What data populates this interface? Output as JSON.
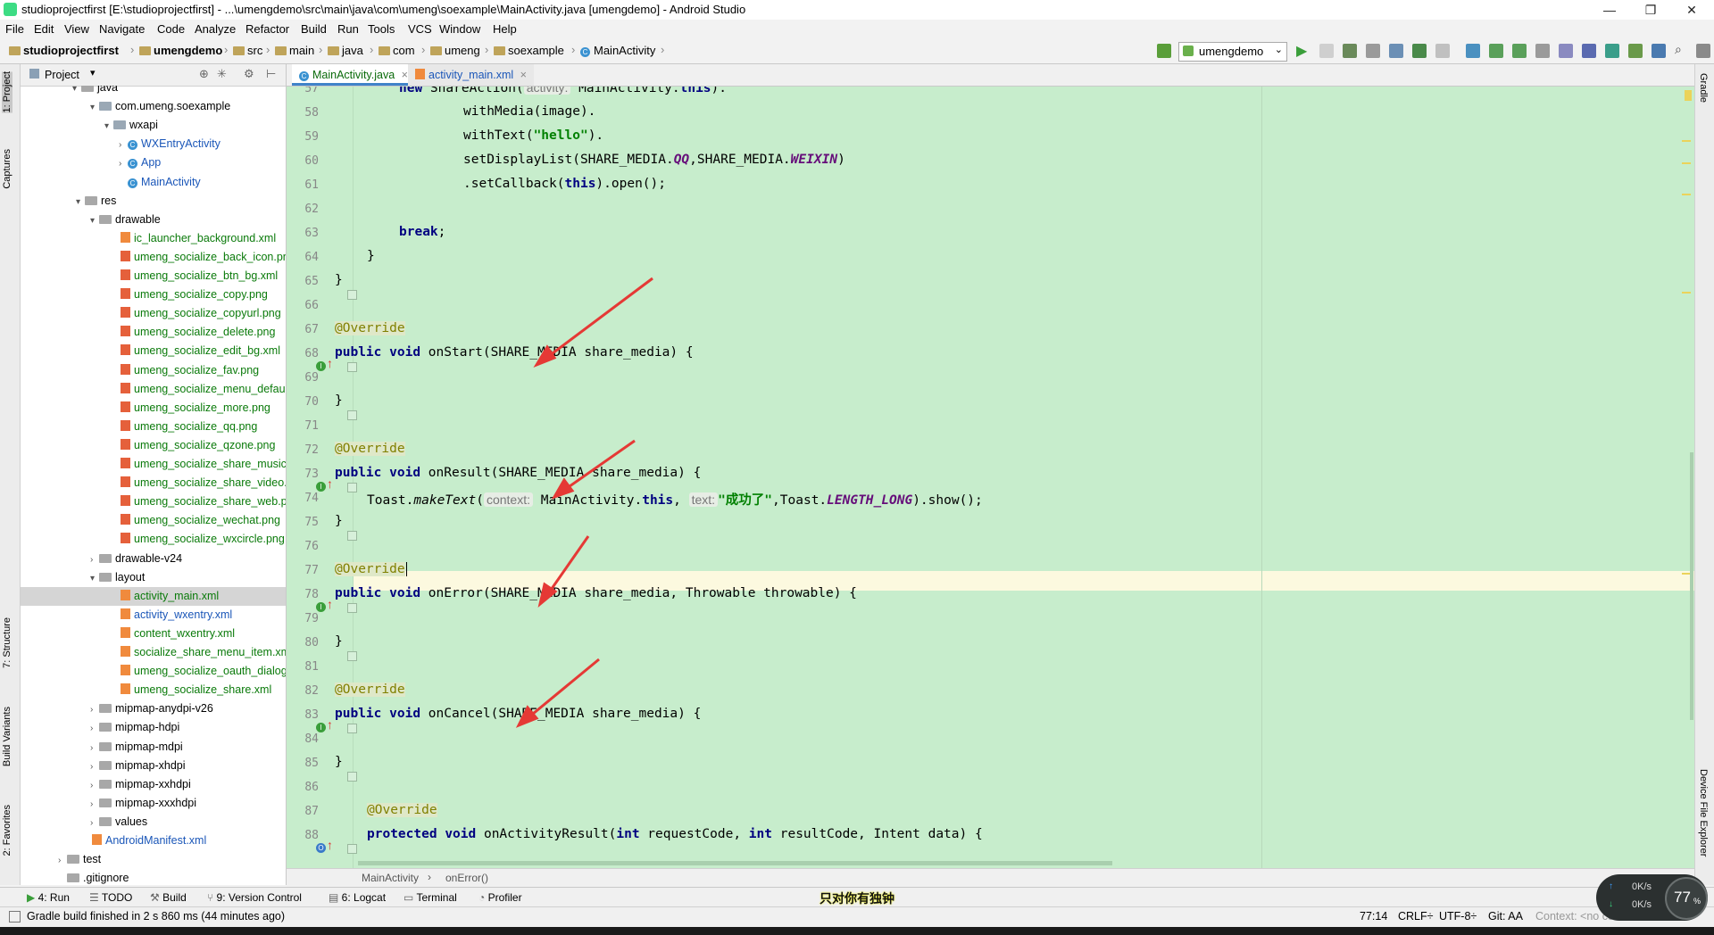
{
  "window": {
    "title": "studioprojectfirst [E:\\studioprojectfirst] - ...\\umengdemo\\src\\main\\java\\com\\umeng\\soexample\\MainActivity.java [umengdemo] - Android Studio",
    "minimize": "—",
    "maximize": "❐",
    "close": "✕"
  },
  "menu": [
    "File",
    "Edit",
    "View",
    "Navigate",
    "Code",
    "Analyze",
    "Refactor",
    "Build",
    "Run",
    "Tools",
    "VCS",
    "Window",
    "Help"
  ],
  "breadcrumb": [
    "studioprojectfirst",
    "umengdemo",
    "src",
    "main",
    "java",
    "com",
    "umeng",
    "soexample",
    "MainActivity"
  ],
  "run_config": "umengdemo",
  "left_tabs": {
    "project": "1: Project",
    "captures": "Captures",
    "structure": "7: Structure",
    "build_variants": "Build Variants",
    "favorites": "2: Favorites"
  },
  "right_tabs": {
    "gradle": "Gradle",
    "device_file_explorer": "Device File Explorer"
  },
  "project_panel": {
    "header": "Project",
    "tree": [
      {
        "label": "java",
        "type": "folder",
        "arrow": "▾"
      },
      {
        "label": "com.umeng.soexample",
        "type": "pkg",
        "arrow": "▾"
      },
      {
        "label": "wxapi",
        "type": "pkg",
        "arrow": "▾"
      },
      {
        "label": "WXEntryActivity",
        "type": "class",
        "arrow": "›"
      },
      {
        "label": "App",
        "type": "class",
        "arrow": "›"
      },
      {
        "label": "MainActivity",
        "type": "class",
        "arrow": ""
      },
      {
        "label": "res",
        "type": "folder",
        "arrow": "▾"
      },
      {
        "label": "drawable",
        "type": "folder",
        "arrow": "▾"
      },
      {
        "label": "ic_launcher_background.xml",
        "type": "xml",
        "arrow": ""
      },
      {
        "label": "umeng_socialize_back_icon.png",
        "type": "img",
        "arrow": ""
      },
      {
        "label": "umeng_socialize_btn_bg.xml",
        "type": "img",
        "arrow": ""
      },
      {
        "label": "umeng_socialize_copy.png",
        "type": "img",
        "arrow": ""
      },
      {
        "label": "umeng_socialize_copyurl.png",
        "type": "img",
        "arrow": ""
      },
      {
        "label": "umeng_socialize_delete.png",
        "type": "img",
        "arrow": ""
      },
      {
        "label": "umeng_socialize_edit_bg.xml",
        "type": "img",
        "arrow": ""
      },
      {
        "label": "umeng_socialize_fav.png",
        "type": "img",
        "arrow": ""
      },
      {
        "label": "umeng_socialize_menu_default.png",
        "type": "img",
        "arrow": ""
      },
      {
        "label": "umeng_socialize_more.png",
        "type": "img",
        "arrow": ""
      },
      {
        "label": "umeng_socialize_qq.png",
        "type": "img",
        "arrow": ""
      },
      {
        "label": "umeng_socialize_qzone.png",
        "type": "img",
        "arrow": ""
      },
      {
        "label": "umeng_socialize_share_music.png",
        "type": "img",
        "arrow": ""
      },
      {
        "label": "umeng_socialize_share_video.png",
        "type": "img",
        "arrow": ""
      },
      {
        "label": "umeng_socialize_share_web.png",
        "type": "img",
        "arrow": ""
      },
      {
        "label": "umeng_socialize_wechat.png",
        "type": "img",
        "arrow": ""
      },
      {
        "label": "umeng_socialize_wxcircle.png",
        "type": "img",
        "arrow": ""
      },
      {
        "label": "drawable-v24",
        "type": "folder",
        "arrow": "›"
      },
      {
        "label": "layout",
        "type": "folder",
        "arrow": "▾"
      },
      {
        "label": "activity_main.xml",
        "type": "xml",
        "arrow": "",
        "selected": true
      },
      {
        "label": "activity_wxentry.xml",
        "type": "xml",
        "arrow": ""
      },
      {
        "label": "content_wxentry.xml",
        "type": "xml",
        "arrow": ""
      },
      {
        "label": "socialize_share_menu_item.xml",
        "type": "xml",
        "arrow": ""
      },
      {
        "label": "umeng_socialize_oauth_dialog.xml",
        "type": "xml",
        "arrow": ""
      },
      {
        "label": "umeng_socialize_share.xml",
        "type": "xml",
        "arrow": ""
      },
      {
        "label": "mipmap-anydpi-v26",
        "type": "folder",
        "arrow": "›"
      },
      {
        "label": "mipmap-hdpi",
        "type": "folder",
        "arrow": "›"
      },
      {
        "label": "mipmap-mdpi",
        "type": "folder",
        "arrow": "›"
      },
      {
        "label": "mipmap-xhdpi",
        "type": "folder",
        "arrow": "›"
      },
      {
        "label": "mipmap-xxhdpi",
        "type": "folder",
        "arrow": "›"
      },
      {
        "label": "mipmap-xxxhdpi",
        "type": "folder",
        "arrow": "›"
      },
      {
        "label": "values",
        "type": "folder",
        "arrow": "›"
      },
      {
        "label": "AndroidManifest.xml",
        "type": "xml",
        "arrow": ""
      },
      {
        "label": "test",
        "type": "folder",
        "arrow": "›"
      },
      {
        "label": ".gitignore",
        "type": "file",
        "arrow": ""
      }
    ]
  },
  "tabs": [
    {
      "label": "MainActivity.java",
      "close": "×"
    },
    {
      "label": "activity_main.xml",
      "close": "×"
    }
  ],
  "editor": {
    "line_numbers": [
      "57",
      "58",
      "59",
      "60",
      "61",
      "62",
      "63",
      "64",
      "65",
      "66",
      "67",
      "68",
      "69",
      "70",
      "71",
      "72",
      "73",
      "74",
      "75",
      "76",
      "77",
      "78",
      "79",
      "80",
      "81",
      "82",
      "83",
      "84",
      "85",
      "86",
      "87",
      "88"
    ],
    "tokens": {
      "l57_kw": "new",
      "l57_a": " ShareAction(",
      "l57_hint": "activity:",
      "l57_b": " MainActivity.",
      "l57_this": "this",
      "l57_c": ").",
      "l58": "withMedia(image).",
      "l59_a": "withText(",
      "l59_str": "\"hello\"",
      "l59_b": ").",
      "l60_a": "setDisplayList(SHARE_MEDIA.",
      "l60_qq": "QQ",
      "l60_b": ",SHARE_MEDIA.",
      "l60_wx": "WEIXIN",
      "l60_c": ")",
      "l61_a": ".setCallback(",
      "l61_this": "this",
      "l61_b": ").open();",
      "l63_kw": "break",
      "l63_a": ";",
      "brace_close": "}",
      "override": "@Override",
      "kw_public": "public",
      "kw_void": "void",
      "kw_protected": "protected",
      "kw_int": "int",
      "kw_this": "this",
      "l68_rest": " onStart(SHARE_MEDIA share_media) {",
      "l73_rest": " onResult(SHARE_MEDIA share_media) {",
      "l74_a": "Toast.",
      "l74_make": "makeText",
      "l74_b": "(",
      "l74_hint1": "context:",
      "l74_c": " MainActivity.",
      "l74_d": ",",
      "l74_hint2": "text:",
      "l74_str": "\"成功了\"",
      "l74_e": ",Toast.",
      "l74_fld": "LENGTH_LONG",
      "l74_f": ").show();",
      "l78_rest": " onError(SHARE_MEDIA share_media, Throwable throwable) {",
      "l83_rest": " onCancel(SHARE_MEDIA share_media) {",
      "l88_a": " onActivityResult(",
      "l88_b": " requestCode, ",
      "l88_c": " resultCode, Intent data) {"
    }
  },
  "editor_breadcrumb": [
    "MainActivity",
    "onError()"
  ],
  "bottom_tabs": [
    "4: Run",
    "TODO",
    "Build",
    "9: Version Control",
    "6: Logcat",
    "Terminal",
    "Profiler"
  ],
  "status": {
    "message": "Gradle build finished in 2 s 860 ms (44 minutes ago)",
    "position": "77:14",
    "line_sep": "CRLF÷",
    "encoding": "UTF-8÷",
    "git": "Git: AA",
    "context": "Context: <no context>",
    "overlay_text": "只对你有独钟"
  },
  "net_widget": {
    "up": "0K/s",
    "down": "0K/s",
    "percent": "77",
    "unit": "%"
  },
  "colors": {
    "editor_bg": "#c7edcc",
    "current_line": "#fcf9df",
    "keyword": "#000080",
    "annotation": "#808000",
    "string": "#008000",
    "field": "#660e7a",
    "arrow": "#e53935"
  }
}
